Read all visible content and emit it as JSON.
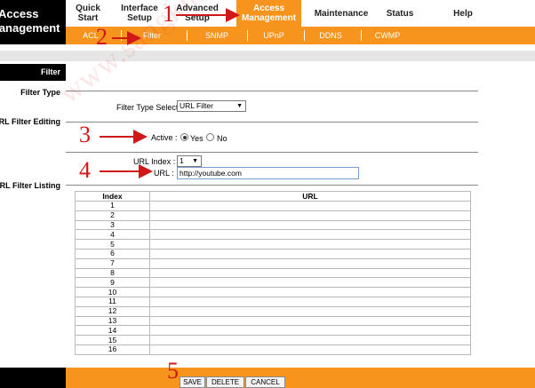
{
  "brand": {
    "line1": "Access",
    "line2": "Management"
  },
  "topnav": [
    {
      "label": "Quick\nStart"
    },
    {
      "label": "Interface\nSetup"
    },
    {
      "label": "Advanced\nSetup"
    },
    {
      "label": "Access\nManagement"
    },
    {
      "label": "Maintenance"
    },
    {
      "label": "Status"
    },
    {
      "label": "Help"
    }
  ],
  "subnav": [
    "ACL",
    "Filter",
    "SNMP",
    "UPnP",
    "DDNS",
    "CWMP"
  ],
  "sidebar": {
    "header": "Filter",
    "filter_type": "Filter Type",
    "url_filter_editing": "URL Filter Editing",
    "url_filter_listing": "URL Filter Listing"
  },
  "form": {
    "filter_type_selection_label": "Filter Type Selection :",
    "filter_type_selection_value": "URL Filter",
    "active_label": "Active :",
    "active_yes": "Yes",
    "active_no": "No",
    "url_index_label": "URL Index :",
    "url_index_value": "1",
    "url_label": "URL :",
    "url_value": "http://youtube.com"
  },
  "table": {
    "headers": [
      "Index",
      "URL"
    ],
    "rows": [
      "1",
      "2",
      "3",
      "4",
      "5",
      "6",
      "7",
      "8",
      "9",
      "10",
      "11",
      "12",
      "13",
      "14",
      "15",
      "16"
    ]
  },
  "buttons": {
    "save": "SAVE",
    "delete": "DELETE",
    "cancel": "CANCEL"
  },
  "annotations": [
    "1",
    "2",
    "3",
    "4",
    "5"
  ],
  "watermark": "www.sangkhia.com.np",
  "colors": {
    "accent": "#f7941d",
    "annotation": "#d01818"
  }
}
